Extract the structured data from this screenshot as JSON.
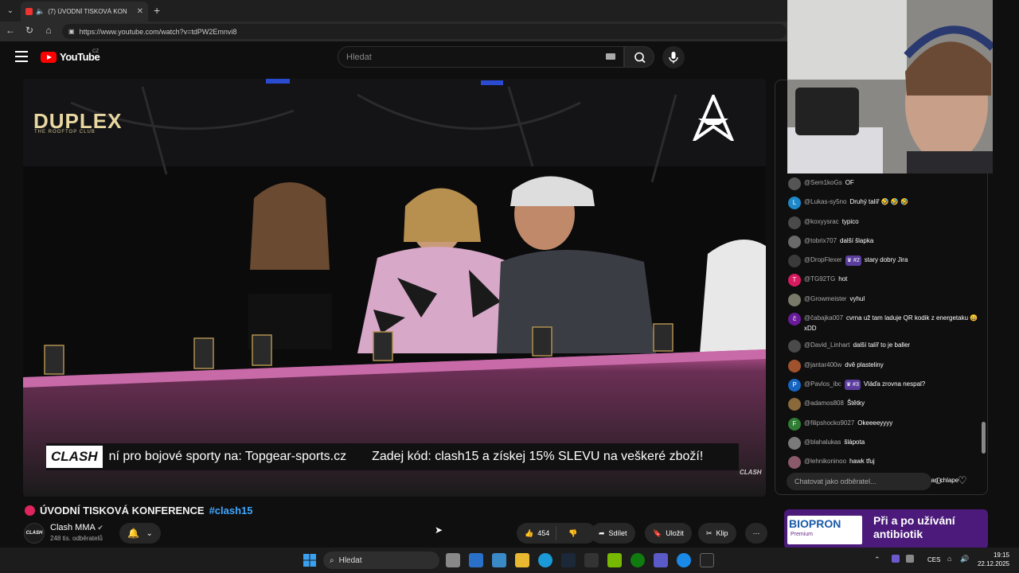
{
  "browser": {
    "tab_title": "(7) ÚVODNÍ TISKOVÁ KONF",
    "url": "https://www.youtube.com/watch?v=tdPW2Emnvi8"
  },
  "header": {
    "logo": "YouTube",
    "country": "CZ",
    "search_placeholder": "Hledat"
  },
  "video": {
    "sponsor_logo": "DUPLEX",
    "sponsor_sub": "THE ROOFTOP CLUB",
    "banner_left": "ní pro bojové sporty na: Topgear-sports.cz",
    "banner_right": "Zadej kód: clash15 a získej 15% SLEVU na veškeré zboží!",
    "banner_brand": "CLASH",
    "corner_brand": "CLASH"
  },
  "title": {
    "text": "ÚVODNÍ TISKOVÁ KONFERENCE",
    "hashtag": "#clash15"
  },
  "channel": {
    "avatar_text": "CLASH",
    "name": "Clash MMA",
    "subscribers": "248 tis. odběratelů"
  },
  "actions": {
    "likes": "454",
    "share": "Sdílet",
    "save": "Uložit",
    "clip": "Klip"
  },
  "chat": {
    "messages": [
      {
        "initial": "",
        "color": "#555555",
        "author": "@Sem1koGs",
        "badge": "",
        "text": "OF"
      },
      {
        "initial": "L",
        "color": "#1e88c8",
        "author": "@Lukas-sy5no",
        "badge": "",
        "text": "Druhý talíř 🤣 🤣 🤣"
      },
      {
        "initial": "",
        "color": "#4a4a4a",
        "author": "@koxyysrac",
        "badge": "",
        "text": "typico"
      },
      {
        "initial": "",
        "color": "#6a6a6a",
        "author": "@tobrix707",
        "badge": "",
        "text": "další šlapka"
      },
      {
        "initial": "",
        "color": "#3a3a3a",
        "author": "@DropFlexer",
        "badge": "#2",
        "text": "stary dobry Jira"
      },
      {
        "initial": "T",
        "color": "#d81b60",
        "author": "@TG92TG",
        "badge": "",
        "text": "hot"
      },
      {
        "initial": "",
        "color": "#7a7a6a",
        "author": "@Growmeister",
        "badge": "",
        "text": "vyhul"
      },
      {
        "initial": "č",
        "color": "#6a1b9a",
        "author": "@čabajka007",
        "badge": "",
        "text": "cvrna už tam laduje QR kodik z energetaku 😄 xDD"
      },
      {
        "initial": "",
        "color": "#4a4a4a",
        "author": "@David_Linhart",
        "badge": "",
        "text": "další talíř to je baller"
      },
      {
        "initial": "",
        "color": "#a0522d",
        "author": "@jantar400w",
        "badge": "",
        "text": "dvě plasteliny"
      },
      {
        "initial": "P",
        "color": "#1565c0",
        "author": "@Pavlos_ibc",
        "badge": "#3",
        "text": "Vláďa zrovna nespal?"
      },
      {
        "initial": "",
        "color": "#8a6a3a",
        "author": "@adamos808",
        "badge": "",
        "text": "Štětky"
      },
      {
        "initial": "F",
        "color": "#2e7d32",
        "author": "@filipshocko9027",
        "badge": "",
        "text": "Okeeeeyyyy"
      },
      {
        "initial": "",
        "color": "#7a7a7a",
        "author": "@blahalukas",
        "badge": "",
        "text": "šlápota"
      },
      {
        "initial": "",
        "color": "#8a5a6a",
        "author": "@lehnikoninoo",
        "badge": "",
        "text": "hawk tfuj"
      },
      {
        "initial": "",
        "color": "#9a8a5a",
        "author": "@therepairman747",
        "badge": "",
        "text": "Winner 🏅 Nezhugron Čau chlape"
      }
    ],
    "input_placeholder": "Chatovat jako odběratel..."
  },
  "ad": {
    "brand": "BIOPRON",
    "brand_sub": "Premium",
    "headline": "Při a po užívání antibiotik"
  },
  "taskbar": {
    "search": "Hledat",
    "lang": "CES",
    "time": "19:15",
    "date": "22.12.2025"
  },
  "colors": {
    "accent_red": "#ff0000",
    "link_blue": "#3ea6ff",
    "member_badge": "#5b3d9e",
    "ad_bg": "#4b1a7a"
  }
}
